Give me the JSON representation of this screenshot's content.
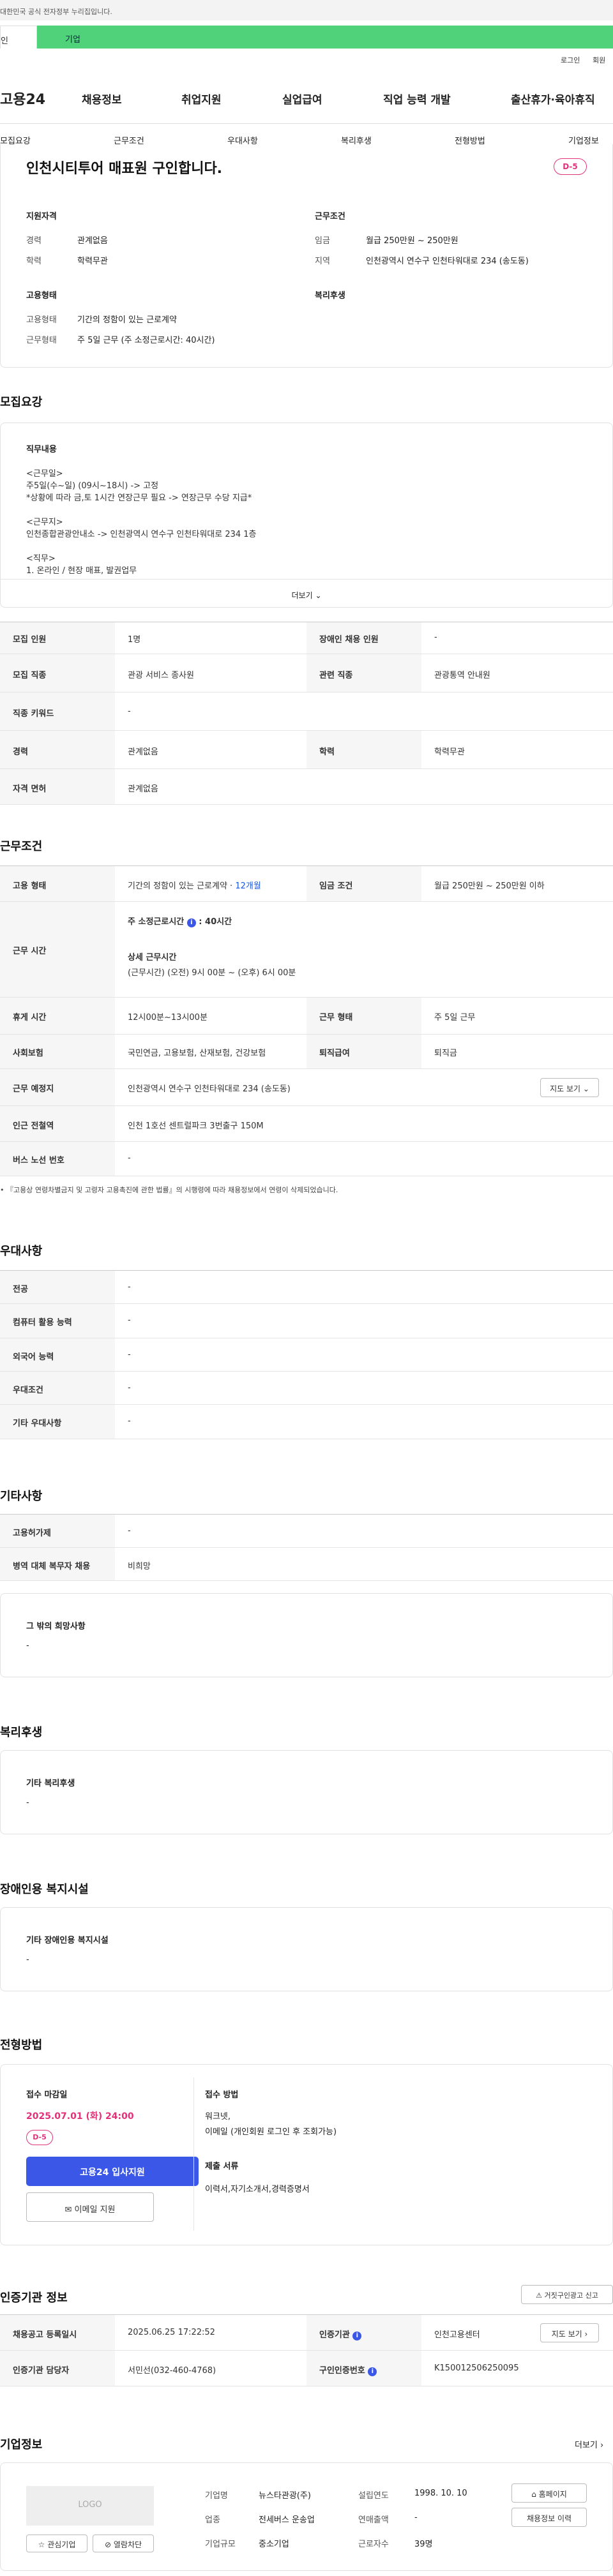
{
  "gov_banner": "대한민국 공식 전자정부 누리집입니다.",
  "audience_tabs": {
    "person": "인",
    "corp": "기업"
  },
  "util": {
    "login": "로그인",
    "join": "회원"
  },
  "header": {
    "logo": "고용24",
    "gnb": [
      "채용정보",
      "취업지원",
      "실업급여",
      "직업 능력 개발",
      "출산휴가·육아휴직"
    ]
  },
  "subnav": [
    "모집요강",
    "근무조건",
    "우대사항",
    "복리후생",
    "전형방법",
    "기업정보"
  ],
  "summary": {
    "title": "인천시티투어 매표원 구인합니다.",
    "dday": "D-5",
    "qual_head": "지원자격",
    "qual": [
      {
        "k": "경력",
        "v": "관계없음"
      },
      {
        "k": "학력",
        "v": "학력무관"
      }
    ],
    "cond_head": "근무조건",
    "cond": [
      {
        "k": "임금",
        "v": "월급 250만원 ~ 250만원"
      },
      {
        "k": "지역",
        "v": "인천광역시 연수구 인천타워대로 234 (송도동)"
      }
    ],
    "emp_head": "고용형태",
    "emp": [
      {
        "k": "고용형태",
        "v": "기간의 정함이 있는 근로계약"
      },
      {
        "k": "근무형태",
        "v": "주 5일 근무 (주 소정근로시간: 40시간)"
      }
    ],
    "welfare_head": "복리후생"
  },
  "recruit": {
    "title": "모집요강",
    "duty_head": "직무내용",
    "duty_lines": [
      "<근무일>",
      "주5일(수~일) (09시~18시) -> 고정",
      "*상황에 따라 금,토 1시간 연장근무 필요 -> 연장근무 수당 지급*",
      "",
      "<근무지>",
      "인천종합관광안내소 -> 인천광역시 연수구 인천타워대로 234 1층",
      "",
      "<직무>",
      "1. 온라인 / 현장 매표, 발권업무"
    ],
    "more": "더보기",
    "rows": [
      {
        "k1": "모집 인원",
        "v1": "1명",
        "k2": "장애인 채용 인원",
        "v2": "-"
      },
      {
        "k1": "모집 직종",
        "v1": "관광 서비스 종사원",
        "k2": "관련 직종",
        "v2": "관광통역 안내원"
      },
      {
        "k1": "직종 키워드",
        "v1": "-"
      },
      {
        "k1": "경력",
        "v1": "관계없음",
        "k2": "학력",
        "v2": "학력무관"
      },
      {
        "k1": "자격 면허",
        "v1": "관계없음"
      }
    ]
  },
  "work": {
    "title": "근무조건",
    "emp_type_k": "고용 형태",
    "emp_type_v": "기간의 정함이 있는 근로계약 · ",
    "emp_type_months": "12개월",
    "wage_k": "임금 조건",
    "wage_v": "월급 250만원 ~ 250만원 이하",
    "hours_k": "근무 시간",
    "hours_std_label": "주 소정근로시간",
    "hours_std_val": "40시간",
    "hours_detail_label": "상세 근무시간",
    "hours_detail_val": "(근무시간) (오전) 9시 00분 ~ (오후) 6시 00분",
    "break_k": "휴게 시간",
    "break_v": "12시00분~13시00분",
    "form_k": "근무 형태",
    "form_v": "주 5일 근무",
    "ins_k": "사회보험",
    "ins_v": "국민연금, 고용보험, 산재보험, 건강보험",
    "sev_k": "퇴직급여",
    "sev_v": "퇴직금",
    "loc_k": "근무 예정지",
    "loc_v": "인천광역시 연수구 인천타워대로 234 (송도동)",
    "map_btn": "지도 보기",
    "subway_k": "인근 전철역",
    "subway_v": "인천 1호선 센트럴파크 3번출구 150M",
    "bus_k": "버스 노선 번호",
    "bus_v": "-",
    "note": "『고용상 연령차별금지 및 고령자 고용촉진에 관한 법률』의 시행령에 따라 채용정보에서 연령이 삭제되었습니다."
  },
  "pref": {
    "title": "우대사항",
    "rows": [
      {
        "k": "전공",
        "v": "-"
      },
      {
        "k": "컴퓨터 활용 능력",
        "v": "-"
      },
      {
        "k": "외국어 능력",
        "v": "-"
      },
      {
        "k": "우대조건",
        "v": "-"
      },
      {
        "k": "기타 우대사항",
        "v": "-"
      }
    ]
  },
  "etc": {
    "title": "기타사항",
    "rows": [
      {
        "k": "고용허가제",
        "v": "-"
      },
      {
        "k": "병역 대체 복무자 채용",
        "v": "비희망"
      }
    ],
    "box_head": "그 밖의 희망사항",
    "box_val": "-"
  },
  "welfare": {
    "title": "복리후생",
    "box_head": "기타 복리후생",
    "box_val": "-"
  },
  "disab": {
    "title": "장애인용 복지시설",
    "box_head": "기타 장애인용 복지시설",
    "box_val": "-"
  },
  "process": {
    "title": "전형방법",
    "deadline_head": "접수 마감일",
    "deadline": "2025.07.01 (화) 24:00",
    "dday": "D-5",
    "apply_btn": "고용24 입사지원",
    "email_btn": "이메일 지원",
    "method_head": "접수 방법",
    "method_vals": [
      "워크넷,",
      "이메일 (개인회원 로그인 후 조회가능)"
    ],
    "docs_head": "제출 서류",
    "docs_val": "이력서,자기소개서,경력증명서"
  },
  "cert": {
    "title": "인증기관 정보",
    "report_btn": "거짓구인광고 신고",
    "reg_k": "채용공고 등록일시",
    "reg_v": "2025.06.25 17:22:52",
    "org_k": "인증기관",
    "org_v": "인천고용센터",
    "map_btn": "지도 보기",
    "mgr_k": "인증기관 담당자",
    "mgr_v": "서민선(032-460-4768)",
    "no_k": "구인인증번호",
    "no_v": "K150012506250095"
  },
  "company": {
    "title": "기업정보",
    "more": "더보기",
    "logo": "LOGO",
    "fav_btn": "관심기업",
    "block_btn": "열람차단",
    "f": [
      {
        "k": "기업명",
        "v": "뉴스타관광(주)"
      },
      {
        "k": "업종",
        "v": "전세버스 운송업"
      },
      {
        "k": "기업규모",
        "v": "중소기업"
      }
    ],
    "g": [
      {
        "k": "설립연도",
        "v": "1998. 10. 10"
      },
      {
        "k": "연매출액",
        "v": "-"
      },
      {
        "k": "근로자수",
        "v": "39명"
      }
    ],
    "home_btn": "홈페이지",
    "jobs_btn": "채용정보 이력"
  },
  "colors": {
    "brand_green": "#4fd27a",
    "accent_pink": "#e0327a",
    "primary_blue": "#3a57e8"
  },
  "icons": [
    "chevron-down-icon",
    "info-icon",
    "map-icon",
    "mail-icon",
    "star-icon",
    "block-icon",
    "home-icon",
    "siren-icon",
    "chevron-right-icon"
  ]
}
